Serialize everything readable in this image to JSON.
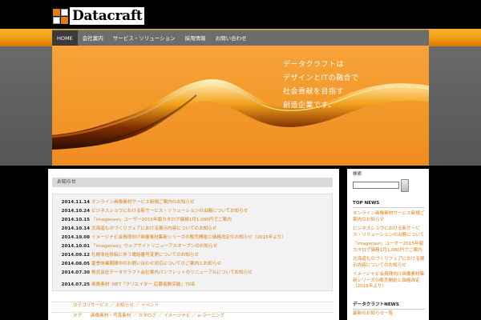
{
  "logo": {
    "text": "Datacraft"
  },
  "nav": {
    "items": [
      {
        "label": "HOME",
        "active": true
      },
      {
        "label": "会社案内"
      },
      {
        "label": "サービス・ソリューション"
      },
      {
        "label": "採用情報"
      },
      {
        "label": "お問い合わせ"
      }
    ]
  },
  "hero": {
    "lines": [
      "データクラフトは",
      "デザインとITの融合で",
      "社会貢献を目指す",
      "創造企業です。"
    ]
  },
  "news": {
    "title": "お知らせ",
    "items": [
      {
        "date": "2014.11.14",
        "text": "オンライン画像素材サービス新規ご案内のお知らせ"
      },
      {
        "date": "2014.10.24",
        "text": "ビジネスショウにおける新サービス・ソリューションの出展についてお知らせ"
      },
      {
        "date": "2014.10.15",
        "text": "「imagenavi」ユーザー2015年版カタログ価格1月1,080円でご案内"
      },
      {
        "date": "2014.10.14",
        "text": "北海道ものづくりフェアにおける展示内容についてのお知らせ"
      },
      {
        "date": "2014.10.08",
        "text": "イメージナビ会員様向け画像素材集新シリーズの販売開始と価格改定のお知らせ（2015年より）"
      },
      {
        "date": "2014.10.01",
        "text": "「imagenavi」ウェブサイトリニューアルオープンのお知らせ"
      },
      {
        "date": "2014.09.12",
        "text": "札幌本社移転に伴う電話番号変更についてのお知らせ"
      },
      {
        "date": "2014.08.05",
        "text": "夏季休業期間中のお問い合わせ対応についてのご案内とお知らせ"
      },
      {
        "date": "2014.07.30",
        "text": "株式会社データクラフト会社案内パンフレットのリニューアルについてお知らせ"
      },
      {
        "date": "2014.07.25",
        "text": "画像素材 .NET「クリエイター 応募者数突破」70名"
      }
    ]
  },
  "categories": [
    {
      "label": "カテゴリ",
      "links": [
        "サービス",
        "お知らせ",
        "イベント"
      ]
    },
    {
      "label": "タグ",
      "links": [
        "画像素材・写真素材",
        "カタログ",
        "イメージナビ",
        "e-ラーニング"
      ]
    }
  ],
  "sidebar": {
    "search_label": "検索",
    "top_news_heading": "TOP NEWS",
    "top_news": [
      "オンライン画像素材サービス新規ご案内のお知らせ",
      "ビジネスショウにおける新サービス・ソリューションの出展について",
      "「imagenavi」ユーザー2015年版カタログ価格1月1,080円でご案内",
      "北海道ものづくりフェアにおける展示内容についてのお知らせ",
      "イメージナビ会員様向け画像素材集新シリーズの販売開始と価格改定（2015年より）"
    ],
    "recent_heading": "データクラフトNEWS",
    "recent": [
      "最新のお知らせ一覧"
    ]
  },
  "colors": {
    "accent": "#e07d10",
    "header_bg": "#000000",
    "stripe": "#f29b0f"
  }
}
